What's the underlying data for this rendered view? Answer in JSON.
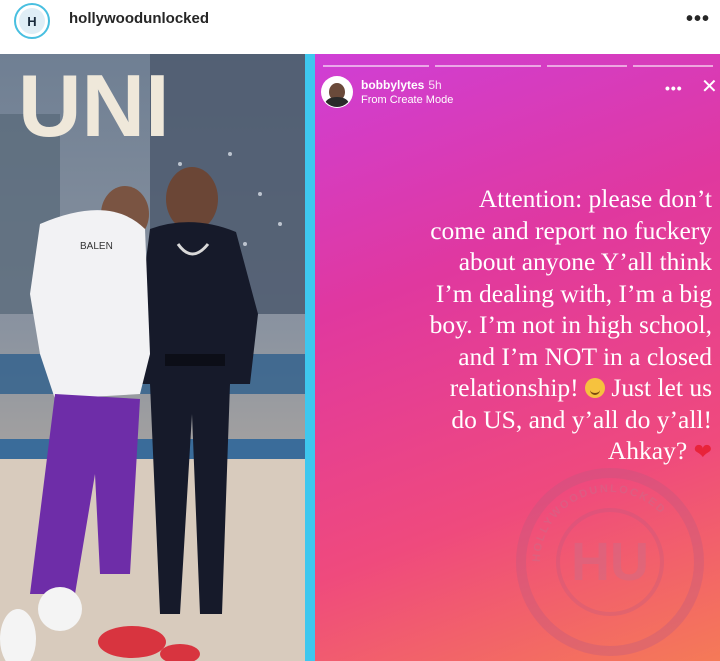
{
  "header": {
    "avatar_initials": "H",
    "username": "hollywoodunlocked",
    "more_icon": "•••"
  },
  "story": {
    "username": "bobbylytes",
    "time": "5h",
    "subtitle": "From Create Mode",
    "more_icon": "•••",
    "close_icon": "✕",
    "caption_lines": [
      "Attention: please don’t",
      "come and report no fuckery",
      "about anyone Y’all think",
      "I’m dealing with, I’m a big",
      "boy. I’m not in high school,",
      "and I’m NOT in a closed",
      "relationship!",
      "Just let us",
      "do US, and y’all do y’all!",
      "Ahkay?"
    ],
    "heart": "❤"
  },
  "photo": {
    "sign_text": "UNI",
    "shirt_text": "BALEN"
  },
  "watermark": {
    "letters": "HU",
    "ring_text": "HOLLYWOODUNLOCKED"
  },
  "colors": {
    "divider": "#3ec7ee",
    "avatar_ring": "#48bfe0",
    "story_gradient_start": "#cf3fd6",
    "story_gradient_end": "#f57a57"
  }
}
